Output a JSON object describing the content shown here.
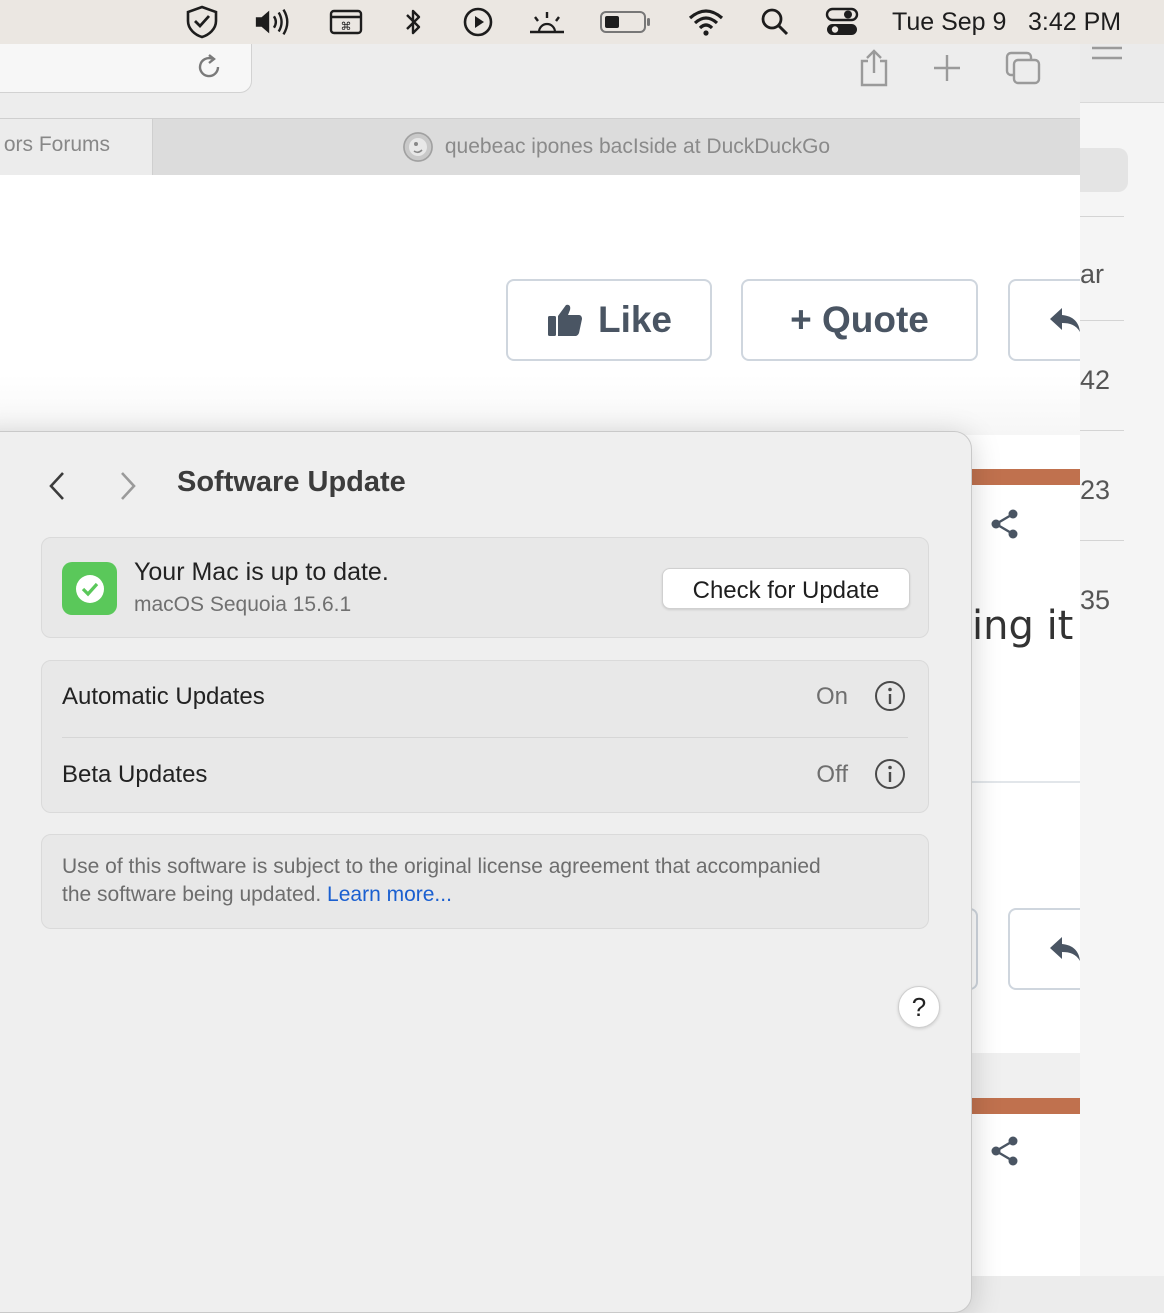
{
  "menubar": {
    "icons": [
      "shield-icon",
      "speaker-icon",
      "keyboard-shortcut-icon",
      "bluetooth-icon",
      "play-icon",
      "brightness-icon",
      "battery-icon",
      "wifi-icon",
      "search-icon",
      "control-center-icon"
    ],
    "date": "Tue Sep 9",
    "time": "3:42 PM"
  },
  "browser": {
    "tabs": [
      {
        "label": "ors Forums"
      },
      {
        "label": "quebeac ipones bacIside at DuckDuckGo"
      }
    ],
    "post_buttons": {
      "like": "Like",
      "quote": "+ Quote"
    },
    "partial_text": "ing it"
  },
  "back_window": {
    "partial_labels": [
      "ar",
      "42",
      "23",
      "35"
    ]
  },
  "settings": {
    "title": "Software Update",
    "status": {
      "title": "Your Mac is up to date.",
      "subtitle": "macOS Sequoia 15.6.1",
      "check_button": "Check for Update"
    },
    "options": [
      {
        "label": "Automatic Updates",
        "value": "On"
      },
      {
        "label": "Beta Updates",
        "value": "Off"
      }
    ],
    "license_text": "Use of this software is subject to the original license agreement that accompanied the software being updated.",
    "learn_more": "Learn more...",
    "help": "?"
  },
  "colors": {
    "accent_green": "#5ac85a",
    "link_blue": "#1a5fd0",
    "forum_accent": "#c0714e"
  }
}
